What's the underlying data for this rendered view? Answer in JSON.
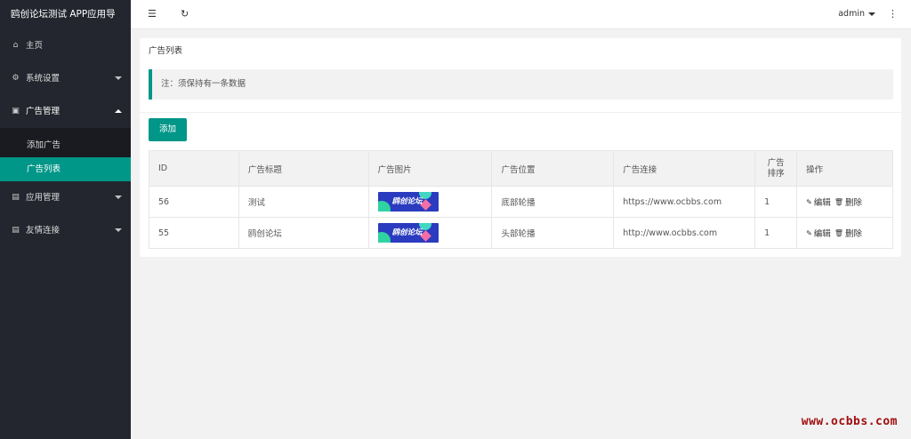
{
  "app": {
    "title": "鸥创论坛测试 APP应用导"
  },
  "sidebar": {
    "items": [
      {
        "label": "主页",
        "icon": "home-icon"
      },
      {
        "label": "系统设置",
        "icon": "gear-icon"
      },
      {
        "label": "广告管理",
        "icon": "ad-icon",
        "open": true,
        "children": [
          {
            "label": "添加广告"
          },
          {
            "label": "广告列表",
            "active": true
          }
        ]
      },
      {
        "label": "应用管理",
        "icon": "app-icon"
      },
      {
        "label": "友情连接",
        "icon": "link-icon"
      }
    ]
  },
  "topbar": {
    "menu_icon": "menu-fold-icon",
    "refresh_icon": "refresh-icon",
    "user": "admin",
    "more_icon": "more-vertical-icon"
  },
  "card": {
    "title": "广告列表",
    "notice": "注：须保持有一条数据",
    "add_label": "添加"
  },
  "table": {
    "headers": [
      "ID",
      "广告标题",
      "广告图片",
      "广告位置",
      "广告连接",
      "广告排序",
      "操作"
    ],
    "header_sort_line1": "广告",
    "header_sort_line2": "排序",
    "rows": [
      {
        "id": "56",
        "title": "测试",
        "image_text": "鸥创论坛",
        "position": "底部轮播",
        "link": "https://www.ocbbs.com",
        "sort": "1",
        "edit": "编辑",
        "delete": "删除"
      },
      {
        "id": "55",
        "title": "鸥创论坛",
        "image_text": "鸥创论坛",
        "position": "头部轮播",
        "link": "http://www.ocbbs.com",
        "sort": "1",
        "edit": "编辑",
        "delete": "删除"
      }
    ]
  },
  "watermark": "www.ocbbs.com",
  "colors": {
    "accent": "#009688",
    "sidebar_bg": "#23262e",
    "watermark": "#a00d0d"
  }
}
